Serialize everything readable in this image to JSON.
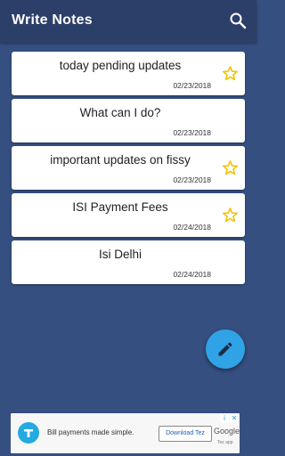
{
  "app": {
    "title": "Write Notes"
  },
  "notes": [
    {
      "title": "today pending updates",
      "date": "02/23/2018",
      "starred": true
    },
    {
      "title": "What can I do?",
      "date": "02/23/2018",
      "starred": false
    },
    {
      "title": "important updates on fissy",
      "date": "02/23/2018",
      "starred": true
    },
    {
      "title": "ISI Payment Fees",
      "date": "02/24/2018",
      "starred": true
    },
    {
      "title": "Isi Delhi",
      "date": "02/24/2018",
      "starred": false
    }
  ],
  "ad": {
    "text": "Bill payments made simple.",
    "cta": "Download Tez",
    "brand": "Google",
    "sub": "Tez app"
  },
  "colors": {
    "background": "#354f80",
    "appbar": "#2b3f69",
    "star": "#f2c200",
    "fab": "#2fa3e6"
  },
  "icons": {
    "search": "search-icon",
    "star": "star-outline-icon",
    "fab": "pencil-icon"
  }
}
